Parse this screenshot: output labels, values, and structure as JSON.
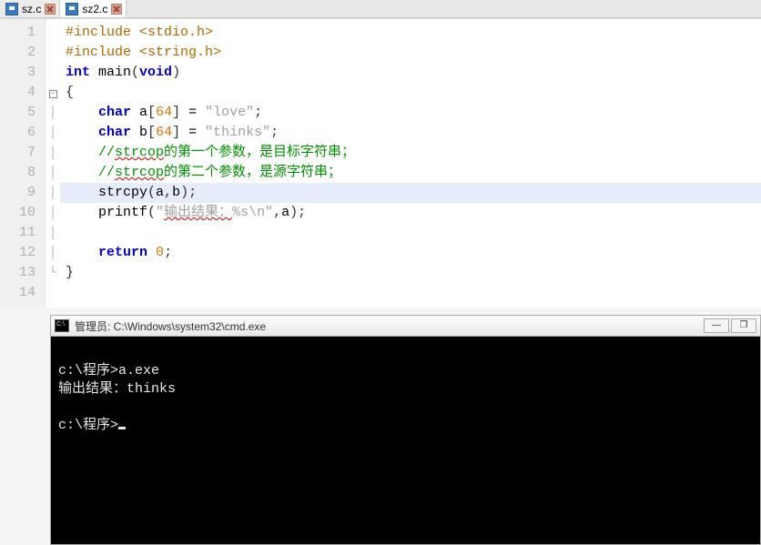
{
  "tabs": [
    {
      "label": "sz.c",
      "active": false
    },
    {
      "label": "sz2.c",
      "active": true
    }
  ],
  "editor": {
    "highlight_line": 9,
    "lines": [
      {
        "n": 1,
        "tokens": [
          [
            "pre",
            "#include "
          ],
          [
            "ang",
            "<stdio.h>"
          ]
        ]
      },
      {
        "n": 2,
        "tokens": [
          [
            "pre",
            "#include "
          ],
          [
            "ang",
            "<string.h>"
          ]
        ]
      },
      {
        "n": 3,
        "tokens": [
          [
            "kw",
            "int"
          ],
          [
            "",
            " main"
          ],
          [
            "punc",
            "("
          ],
          [
            "kw",
            "void"
          ],
          [
            "punc",
            ")"
          ]
        ]
      },
      {
        "n": 4,
        "fold": "start",
        "tokens": [
          [
            "punc",
            "{"
          ]
        ]
      },
      {
        "n": 5,
        "indent": 1,
        "tokens": [
          [
            "kw",
            "char"
          ],
          [
            "",
            " a"
          ],
          [
            "punc",
            "["
          ],
          [
            "num",
            "64"
          ],
          [
            "punc",
            "]"
          ],
          [
            "",
            " = "
          ],
          [
            "str",
            "\"love\""
          ],
          [
            "punc",
            ";"
          ]
        ]
      },
      {
        "n": 6,
        "indent": 1,
        "tokens": [
          [
            "kw",
            "char"
          ],
          [
            "",
            " b"
          ],
          [
            "punc",
            "["
          ],
          [
            "num",
            "64"
          ],
          [
            "punc",
            "]"
          ],
          [
            "",
            " = "
          ],
          [
            "str",
            "\"thinks\""
          ],
          [
            "punc",
            ";"
          ]
        ]
      },
      {
        "n": 7,
        "indent": 1,
        "tokens": [
          [
            "cmt",
            "//"
          ],
          [
            "cmt squig",
            "strcop"
          ],
          [
            "cmt",
            "的第一个参数，是目标字符串；"
          ]
        ]
      },
      {
        "n": 8,
        "indent": 1,
        "tokens": [
          [
            "cmt",
            "//"
          ],
          [
            "cmt squig",
            "strcop"
          ],
          [
            "cmt",
            "的第二个参数，是源字符串；"
          ]
        ]
      },
      {
        "n": 9,
        "indent": 1,
        "tokens": [
          [
            "",
            "strcpy"
          ],
          [
            "punc",
            "("
          ],
          [
            "",
            "a"
          ],
          [
            "punc",
            ","
          ],
          [
            "",
            "b"
          ],
          [
            "punc",
            ")"
          ],
          [
            "punc",
            ";"
          ]
        ]
      },
      {
        "n": 10,
        "indent": 1,
        "tokens": [
          [
            "",
            "printf"
          ],
          [
            "punc",
            "("
          ],
          [
            "str",
            "\""
          ],
          [
            "str squig",
            "输出结果："
          ],
          [
            "str",
            "%s\\n\""
          ],
          [
            "punc",
            ","
          ],
          [
            "",
            "a"
          ],
          [
            "punc",
            ")"
          ],
          [
            "punc",
            ";"
          ]
        ]
      },
      {
        "n": 11,
        "indent": 1,
        "tokens": []
      },
      {
        "n": 12,
        "indent": 1,
        "tokens": [
          [
            "kw",
            "return"
          ],
          [
            "",
            " "
          ],
          [
            "num",
            "0"
          ],
          [
            "punc",
            ";"
          ]
        ]
      },
      {
        "n": 13,
        "fold": "end",
        "tokens": [
          [
            "punc",
            "}"
          ]
        ]
      },
      {
        "n": 14,
        "tokens": []
      }
    ]
  },
  "terminal": {
    "title_prefix": "管理员: ",
    "title_path": "C:\\Windows\\system32\\cmd.exe",
    "lines": [
      "c:\\程序>a.exe",
      "输出结果：thinks",
      "",
      "c:\\程序>"
    ]
  },
  "win_btns": {
    "min": "—",
    "max": "❐"
  }
}
